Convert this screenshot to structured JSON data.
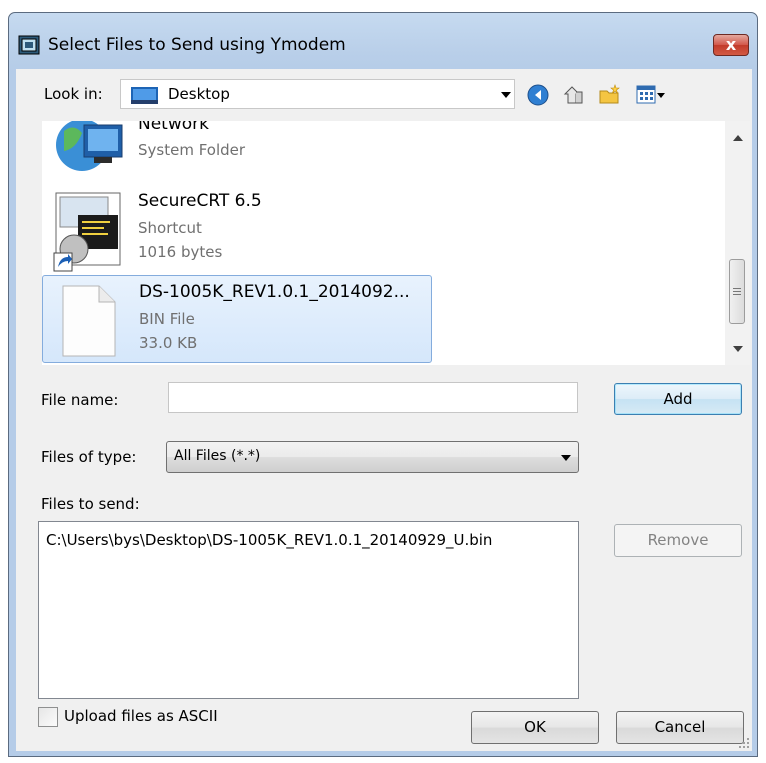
{
  "window": {
    "title": "Select Files to Send using Ymodem",
    "close_label": "x"
  },
  "look_in": {
    "label": "Look in:",
    "value": "Desktop"
  },
  "files": [
    {
      "name": "Network",
      "line2": "System Folder",
      "line3": ""
    },
    {
      "name": "SecureCRT 6.5",
      "line2": "Shortcut",
      "line3": "1016 bytes"
    },
    {
      "name": "DS-1005K_REV1.0.1_2014092...",
      "line2": "BIN File",
      "line3": "33.0 KB",
      "selected": true
    }
  ],
  "file_name": {
    "label": "File name:",
    "value": ""
  },
  "files_of_type": {
    "label": "Files of type:",
    "value": "All Files (*.*)"
  },
  "files_to_send": {
    "label": "Files to send:",
    "items": [
      "C:\\Users\\bys\\Desktop\\DS-1005K_REV1.0.1_20140929_U.bin"
    ]
  },
  "buttons": {
    "add": "Add",
    "remove": "Remove",
    "ok": "OK",
    "cancel": "Cancel"
  },
  "upload_ascii": {
    "label": "Upload files as ASCII",
    "checked": false
  },
  "colors": {
    "accent": "#3c7fb1",
    "selection": "#d5e7fb",
    "close": "#c23b2b"
  }
}
